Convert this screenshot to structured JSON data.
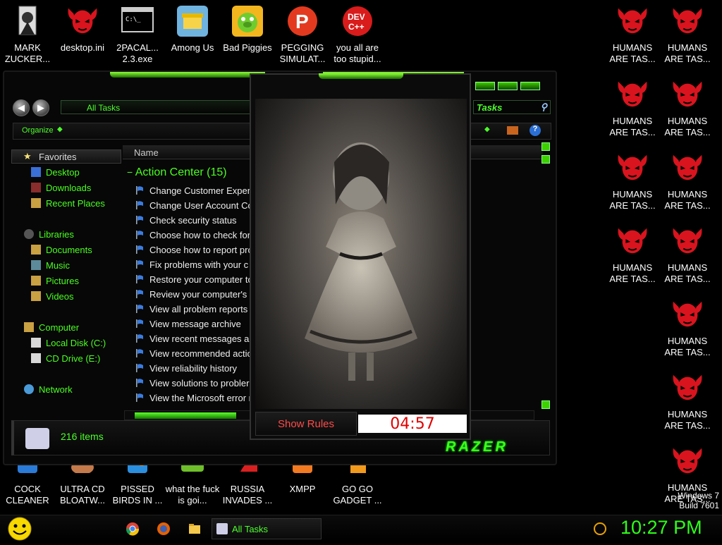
{
  "desktop_icons_top": [
    {
      "label": "MARK ZUCKER...",
      "icon": "zuckerberg-shortcut-icon"
    },
    {
      "label": "desktop.ini",
      "icon": "red-devil-icon"
    },
    {
      "label": "2PACAL... 2.3.exe",
      "icon": "console-exe-icon"
    },
    {
      "label": "Among Us",
      "icon": "among-us-icon"
    },
    {
      "label": "Bad Piggies",
      "icon": "bad-piggies-icon"
    },
    {
      "label": "PEGGING SIMULAT...",
      "icon": "pegging-simulator-icon"
    },
    {
      "label": "you all are too stupid...",
      "icon": "dev-cpp-icon"
    }
  ],
  "desktop_icons_bottom": [
    {
      "label": "COCK CLEANER"
    },
    {
      "label": "ULTRA CD BLOATW..."
    },
    {
      "label": "PISSED BIRDS IN ..."
    },
    {
      "label": "what the fuck is goi..."
    },
    {
      "label": "RUSSIA INVADES ..."
    },
    {
      "label": "XMPP"
    },
    {
      "label": "GO GO GADGET ..."
    }
  ],
  "desktop_icons_right": [
    {
      "label": "HUMANS ARE TAS..."
    }
  ],
  "explorer": {
    "address": "All Tasks",
    "search_placeholder": "Tasks",
    "toolbar_organize": "Organize",
    "favorites_header": "Favorites",
    "sidebar": [
      {
        "label": "Desktop"
      },
      {
        "label": "Downloads"
      },
      {
        "label": "Recent Places"
      },
      {
        "label": "Libraries"
      },
      {
        "label": "Documents"
      },
      {
        "label": "Music"
      },
      {
        "label": "Pictures"
      },
      {
        "label": "Videos"
      },
      {
        "label": "Computer"
      },
      {
        "label": "Local Disk (C:)"
      },
      {
        "label": "CD Drive (E:)"
      },
      {
        "label": "Network"
      }
    ],
    "column_name": "Name",
    "group_title": "Action Center (15)",
    "tasks": [
      "Change Customer Exper",
      "Change User Account Co",
      "Check security status",
      "Choose how to check for",
      "Choose how to report pro",
      "Fix problems with your c",
      "Restore your computer to",
      "Review your computer's s",
      "View all problem reports",
      "View message archive",
      "View recent messages a",
      "View recommended actio",
      "View reliability history",
      "View solutions to probler",
      "View the Microsoft error r"
    ],
    "status_items": "216 items",
    "brand": "RAZER"
  },
  "game": {
    "rules_label": "Show Rules",
    "timer": "04:57"
  },
  "taskbar": {
    "active_window": "All Tasks",
    "clock": "10:27 PM",
    "win_edition": "Windows 7",
    "win_build": "Build 7601"
  },
  "colors": {
    "accent_green": "#49ff1f",
    "devil_red": "#d9141e",
    "timer_red": "#e20000"
  }
}
